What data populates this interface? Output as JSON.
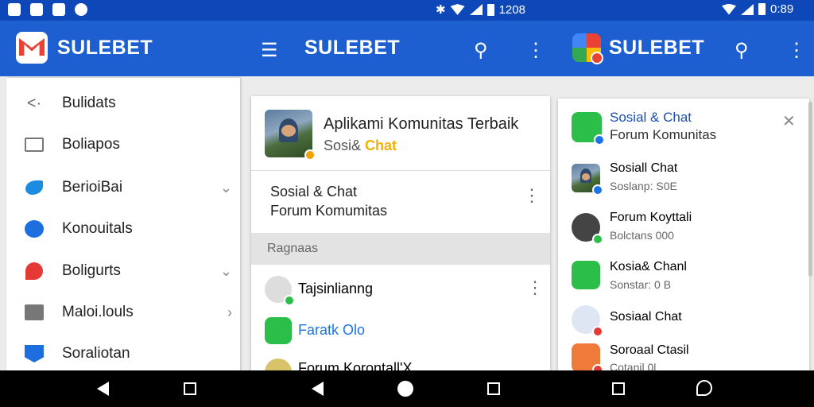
{
  "status": {
    "time1": "1208",
    "time2": "0:89"
  },
  "left": {
    "app_title": "SULEBET"
  },
  "middle": {
    "app_title": "SULEBET"
  },
  "right": {
    "app_title": "SULEBET"
  },
  "drawer": {
    "items": [
      {
        "label": "Bulidats",
        "icon": "share-icon",
        "chevron": ""
      },
      {
        "label": "Boliapos",
        "icon": "mail-icon",
        "chevron": ""
      },
      {
        "label": "BerioiBai",
        "icon": "bird-icon",
        "chevron": "⌄"
      },
      {
        "label": "Konouitals",
        "icon": "chat-icon",
        "chevron": ""
      },
      {
        "label": "Boligurts",
        "icon": "pin-icon",
        "chevron": "⌄"
      },
      {
        "label": "Maloi.louls",
        "icon": "folder-icon",
        "chevron": "›"
      },
      {
        "label": "Soraliotan",
        "icon": "tag-icon",
        "chevron": ""
      }
    ]
  },
  "feed": {
    "header_title": "Aplikami Komunitas Terbaik",
    "header_sub_a": "Sosi&",
    "header_sub_b": "Chat",
    "item1_line1": "Sosial & Chat",
    "item1_line2": "Forum Komumitas",
    "section_label": "Ragnaas",
    "list": [
      {
        "label": "Tajsinlianng",
        "color": "#222"
      },
      {
        "label": "Faratk Olo",
        "color": "#1a73e8"
      },
      {
        "label": "Forum Korontall'X",
        "color": "#222"
      }
    ]
  },
  "side": {
    "header_title": "Sosial & Chat",
    "header_sub": "Forum Komunitas",
    "items": [
      {
        "title": "Sosiall Chat",
        "sub": "Soslanp: S0E"
      },
      {
        "title": "Forum Koyttali",
        "sub": "Bolctans 000"
      },
      {
        "title": "Kosia& Chanl",
        "sub": "Sonstar: 0 B"
      },
      {
        "title": "Sosiaal Chat",
        "sub": ""
      },
      {
        "title": "Soroaal Ctasil",
        "sub": "Cotanil 0l"
      }
    ]
  },
  "colors": {
    "primary": "#1d5fd0",
    "status": "#0d47b8",
    "accent_yellow": "#f2b000",
    "link_blue": "#1a73e8"
  }
}
